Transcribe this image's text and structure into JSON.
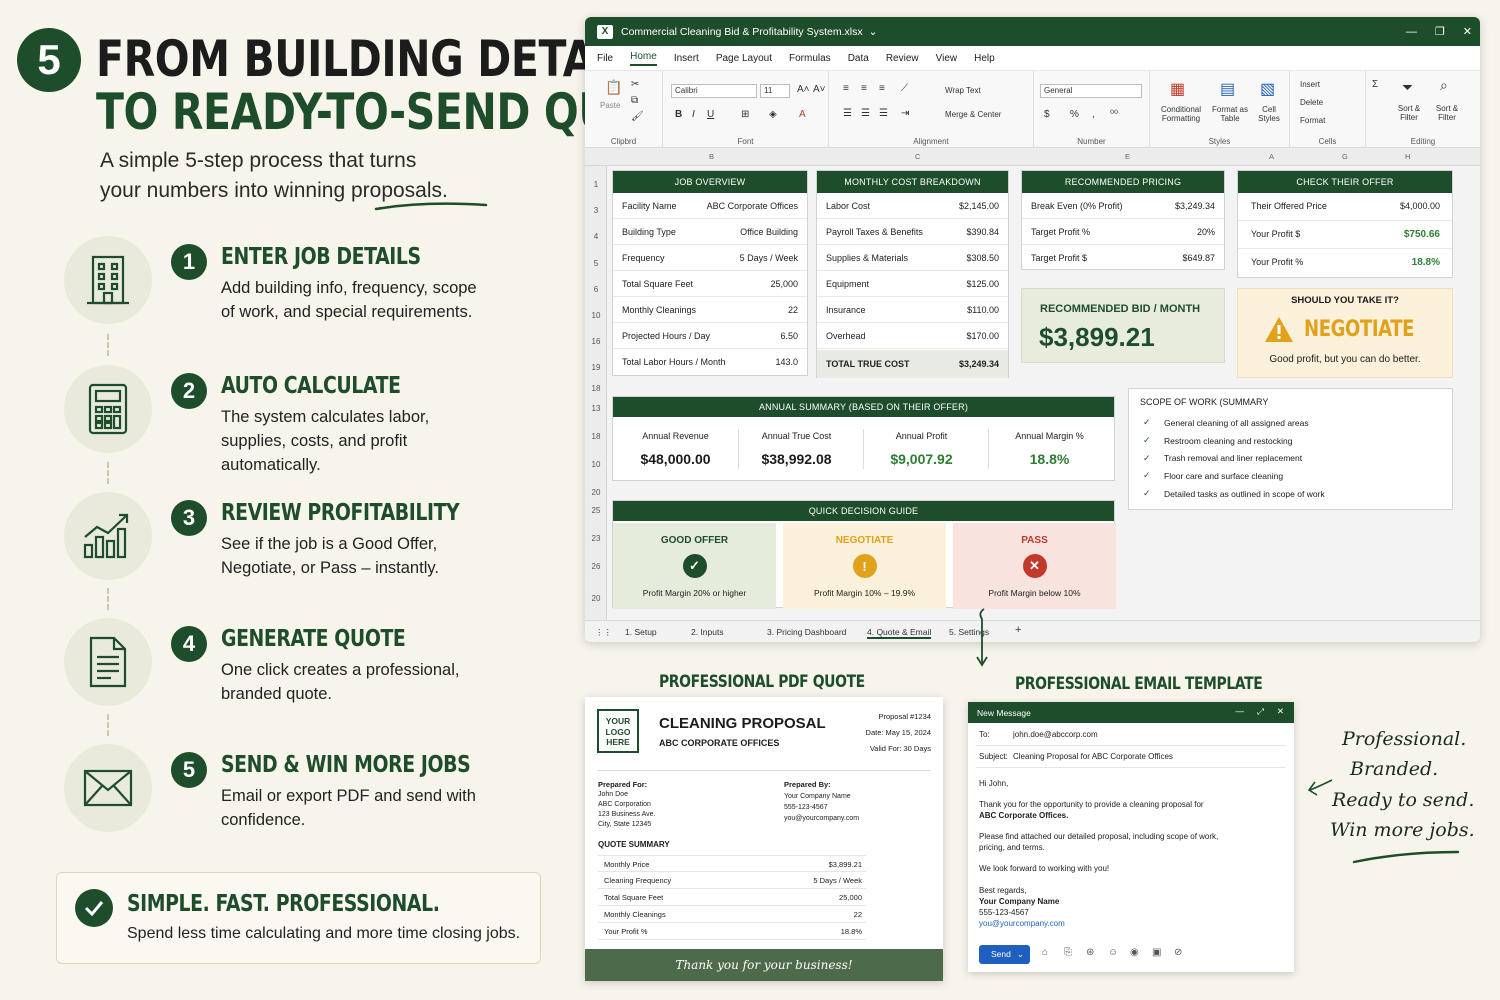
{
  "hero": {
    "step_number": "5",
    "headline_line1": "FROM BUILDING DETAILS",
    "headline_line2": "TO READY-TO-SEND QUOTE",
    "subhead_line1": "A simple 5-step process that turns",
    "subhead_line2": "your numbers into winning proposals."
  },
  "steps": [
    {
      "num": "1",
      "title": "ENTER JOB DETAILS",
      "desc": "Add building info, frequency, scope of work, and special requirements.",
      "icon": "building-icon"
    },
    {
      "num": "2",
      "title": "AUTO CALCULATE",
      "desc": "The system calculates labor, supplies, costs, and profit automatically.",
      "icon": "calculator-icon"
    },
    {
      "num": "3",
      "title": "REVIEW PROFITABILITY",
      "desc": "See if the job is a Good Offer, Negotiate, or Pass – instantly.",
      "icon": "bar-chart-icon"
    },
    {
      "num": "4",
      "title": "GENERATE QUOTE",
      "desc": "One click creates a professional, branded quote.",
      "icon": "document-icon"
    },
    {
      "num": "5",
      "title": "SEND & WIN MORE JOBS",
      "desc": "Email or export PDF and send with confidence.",
      "icon": "envelope-icon"
    }
  ],
  "bottom_box": {
    "title": "SIMPLE. FAST. PROFESSIONAL.",
    "desc": "Spend less time calculating and more time closing jobs."
  },
  "excel": {
    "title": "Commercial Cleaning Bid & Profitability System.xlsx",
    "menu": [
      "File",
      "Home",
      "Insert",
      "Page Layout",
      "Formulas",
      "Data",
      "Review",
      "View",
      "Help"
    ],
    "active_menu": "Home",
    "ribbon": {
      "paste": "Paste",
      "clipboard": "Clipbrd",
      "font_name": "Calibri",
      "font_size": "11",
      "font_group": "Font",
      "wrap_text": "Wrap Text",
      "merge_center": "Merge & Center",
      "alignment_group": "Alignment",
      "number_format": "General",
      "number_group": "Number",
      "conditional_formatting": "Conditional Formatting",
      "format_as_table": "Format as Table",
      "cell_styles": "Cell Styles",
      "styles_group": "Styles",
      "insert": "Insert",
      "delete": "Delete",
      "format": "Format",
      "cells_group": "Cells",
      "sort_filter": "Sort & Filter",
      "find_select": "Sort & Filter",
      "editing_group": "Editing"
    },
    "column_headers": [
      "B",
      "C",
      "E",
      "A",
      "G",
      "H"
    ],
    "row_headers": [
      "1",
      "3",
      "4",
      "5",
      "6",
      "10",
      "16",
      "19",
      "18",
      "13",
      "18",
      "10",
      "20",
      "25",
      "23",
      "26",
      "20"
    ],
    "job_overview": {
      "header": "JOB OVERVIEW",
      "rows": [
        {
          "label": "Facility Name",
          "value": "ABC Corporate Offices"
        },
        {
          "label": "Building Type",
          "value": "Office Building"
        },
        {
          "label": "Frequency",
          "value": "5 Days / Week"
        },
        {
          "label": "Total Square Feet",
          "value": "25,000"
        },
        {
          "label": "Monthly Cleanings",
          "value": "22"
        },
        {
          "label": "Projected Hours / Day",
          "value": "6.50"
        },
        {
          "label": "Total Labor Hours / Month",
          "value": "143.0"
        }
      ]
    },
    "monthly_cost": {
      "header": "MONTHLY COST BREAKDOWN",
      "rows": [
        {
          "label": "Labor Cost",
          "value": "$2,145.00"
        },
        {
          "label": "Payroll Taxes & Benefits",
          "value": "$390.84"
        },
        {
          "label": "Supplies & Materials",
          "value": "$308.50"
        },
        {
          "label": "Equipment",
          "value": "$125.00"
        },
        {
          "label": "Insurance",
          "value": "$110.00"
        },
        {
          "label": "Overhead",
          "value": "$170.00"
        }
      ],
      "total_label": "TOTAL TRUE COST",
      "total_value": "$3,249.34"
    },
    "recommended_pricing": {
      "header": "RECOMMENDED PRICING",
      "rows": [
        {
          "label": "Break Even (0% Profit)",
          "value": "$3,249.34"
        },
        {
          "label": "Target Profit %",
          "value": "20%"
        },
        {
          "label": "Target Profit $",
          "value": "$649.87"
        }
      ],
      "bid_label": "RECOMMENDED BID / MONTH",
      "bid_value": "$3,899.21"
    },
    "check_offer": {
      "header": "CHECK THEIR OFFER",
      "rows": [
        {
          "label": "Their Offered Price",
          "value": "$4,000.00"
        },
        {
          "label": "Your Profit $",
          "value": "$750.66"
        },
        {
          "label": "Your Profit %",
          "value": "18.8%"
        }
      ],
      "should_label": "SHOULD YOU TAKE IT?",
      "verdict": "NEGOTIATE",
      "verdict_note": "Good profit, but you can do better."
    },
    "annual_summary": {
      "header": "ANNUAL SUMMARY (BASED ON THEIR OFFER)",
      "items": [
        {
          "label": "Annual Revenue",
          "value": "$48,000.00"
        },
        {
          "label": "Annual True Cost",
          "value": "$38,992.08"
        },
        {
          "label": "Annual Profit",
          "value": "$9,007.92"
        },
        {
          "label": "Annual Margin %",
          "value": "18.8%"
        }
      ]
    },
    "scope": {
      "title": "SCOPE OF WORK (SUMMARY",
      "items": [
        "General cleaning of all assigned areas",
        "Restroom cleaning and restocking",
        "Trash removal and liner replacement",
        "Floor care and surface cleaning",
        "Detailed tasks as outlined in scope of work"
      ]
    },
    "quick_guide": {
      "header": "QUICK DECISION GUIDE",
      "cards": [
        {
          "title": "GOOD OFFER",
          "desc": "Profit Margin 20% or higher",
          "bg": "#e6ecdc",
          "color": "#1e4d2b",
          "glyph": "✓"
        },
        {
          "title": "NEGOTIATE",
          "desc": "Profit Margin 10% – 19.9%",
          "bg": "#fbf0d9",
          "color": "#e0a11b",
          "glyph": "!"
        },
        {
          "title": "PASS",
          "desc": "Profit Margin below 10%",
          "bg": "#f8e3df",
          "color": "#c0392b",
          "glyph": "✕"
        }
      ]
    },
    "tabs": [
      "1. Setup",
      "2. Inputs",
      "3. Pricing Dashboard",
      "4. Quote & Email",
      "5. Settings"
    ],
    "active_tab": "4. Quote & Email"
  },
  "pdf_quote": {
    "section_label": "PROFESSIONAL PDF QUOTE",
    "logo_lines": [
      "YOUR",
      "LOGO",
      "HERE"
    ],
    "title": "CLEANING PROPOSAL",
    "client": "ABC CORPORATE OFFICES",
    "proposal_no": "Proposal #1234",
    "date": "Date: May 15, 2024",
    "valid": "Valid For: 30 Days",
    "prepared_for_label": "Prepared For:",
    "prepared_for": [
      "John Doe",
      "ABC Corporation",
      "123 Business Ave.",
      "City, State 12345"
    ],
    "prepared_by_label": "Prepared By:",
    "prepared_by": [
      "Your Company Name",
      "555-123-4567",
      "you@yourcompany.com"
    ],
    "summary_label": "QUOTE SUMMARY",
    "summary": [
      {
        "label": "Monthly Price",
        "value": "$3,899.21"
      },
      {
        "label": "Cleaning Frequency",
        "value": "5 Days / Week"
      },
      {
        "label": "Total Square Feet",
        "value": "25,000"
      },
      {
        "label": "Monthly Cleanings",
        "value": "22"
      },
      {
        "label": "Your Profit %",
        "value": "18.8%"
      }
    ],
    "footer": "Thank you for your business!"
  },
  "email": {
    "section_label": "PROFESSIONAL EMAIL TEMPLATE",
    "window_title": "New Message",
    "to_label": "To:",
    "to": "john.doe@abccorp.com",
    "subject_label": "Subject:",
    "subject": "Cleaning Proposal for ABC Corporate Offices",
    "greeting": "Hi John,",
    "p1_line1": "Thank you for the opportunity to provide a cleaning proposal for",
    "p1_line2": "ABC Corporate Offices.",
    "p2_line1": "Please find attached our detailed proposal, including scope of work,",
    "p2_line2": "pricing, and terms.",
    "p3": "We look forward to working with you!",
    "signoff": "Best regards,",
    "sig_company": "Your Company Name",
    "sig_phone": "555-123-4567",
    "sig_email": "you@yourcompany.com",
    "send": "Send"
  },
  "tagline": [
    "Professional.",
    "Branded.",
    "Ready to send.",
    "Win more jobs."
  ],
  "colors": {
    "brand_green": "#1e4d2b",
    "warning_orange": "#e0a11b",
    "pass_red": "#c0392b",
    "background": "#f7f4ec"
  }
}
